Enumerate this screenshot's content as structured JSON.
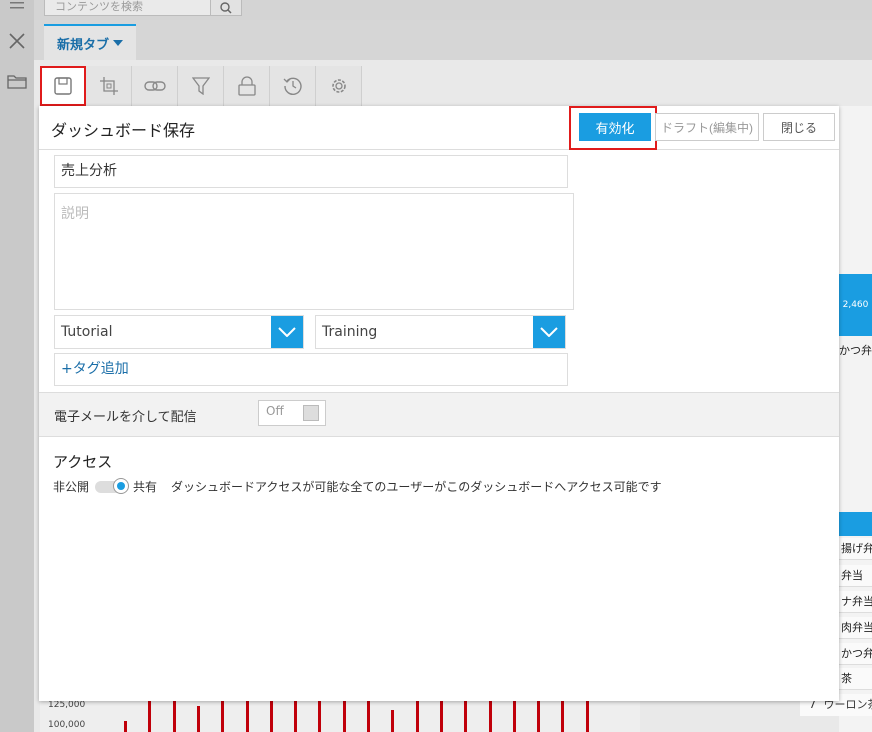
{
  "topbar": {
    "search_placeholder": "コンテンツを検索"
  },
  "tabs": [
    {
      "label": "新規タブ"
    }
  ],
  "toolbar": {
    "tools": [
      "save-icon",
      "crop-icon",
      "link-icon",
      "filter-icon",
      "lock-icon",
      "history-icon",
      "gear-icon"
    ]
  },
  "dialog": {
    "title": "ダッシュボード保存",
    "activate_label": "有効化",
    "draft_label": "ドラフト(編集中)",
    "close_label": "閉じる",
    "name_value": "売上分析",
    "description_placeholder": "説明",
    "category_value": "Tutorial",
    "subcategory_value": "Training",
    "tag_add_label": "+タグ追加",
    "email_label": "電子メールを介して配信",
    "email_toggle": "Off",
    "access_title": "アクセス",
    "access_private": "非公開",
    "access_shared": "共有",
    "access_description": "ダッシュボードアクセスが可能な全てのユーザーがこのダッシュボードへアクセス可能です"
  },
  "background": {
    "card_value": "2,460",
    "card_label": "かつ弁当",
    "rows": [
      "揚げ弁当",
      "弁当",
      "ナ弁当",
      "肉弁当",
      "かつ弁",
      "茶"
    ],
    "last_row_rank": "7",
    "last_row_label": "ウーロン茶",
    "axis_labels": [
      "125,000",
      "100,000"
    ],
    "bar_levels": [
      0.35,
      1,
      1,
      0.8,
      1,
      1,
      1,
      1,
      1,
      1,
      1,
      0.7,
      1,
      1,
      1,
      1,
      1,
      1,
      1,
      1
    ]
  },
  "colors": {
    "accent": "#1a9de1",
    "highlight": "#e01b1b",
    "bar": "#c0000a"
  }
}
